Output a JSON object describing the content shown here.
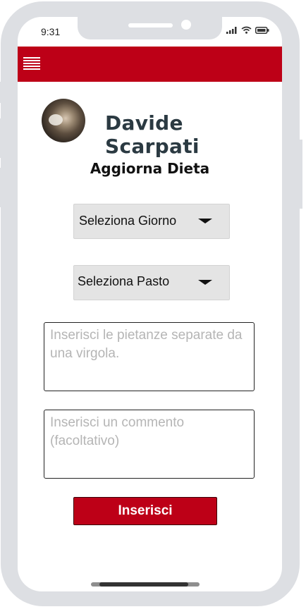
{
  "status_bar": {
    "time": "9:31",
    "icons": [
      "signal-icon",
      "wifi-icon",
      "battery-icon"
    ]
  },
  "app_bar": {
    "menu_icon": "hamburger-menu-icon",
    "color": "#bd0017"
  },
  "profile": {
    "name": "Davide Scarpati",
    "avatar": "profile-photo"
  },
  "form": {
    "title": "Aggiorna Dieta",
    "day_select": {
      "selected": "Seleziona Giorno"
    },
    "meal_select": {
      "selected": "Seleziona Pasto"
    },
    "dishes_field": {
      "placeholder": "Inserisci le pietanze separate da una virgola.",
      "value": ""
    },
    "comment_field": {
      "placeholder": "Inserisci un commento (facoltativo)",
      "value": ""
    },
    "submit_label": "Inserisci"
  }
}
